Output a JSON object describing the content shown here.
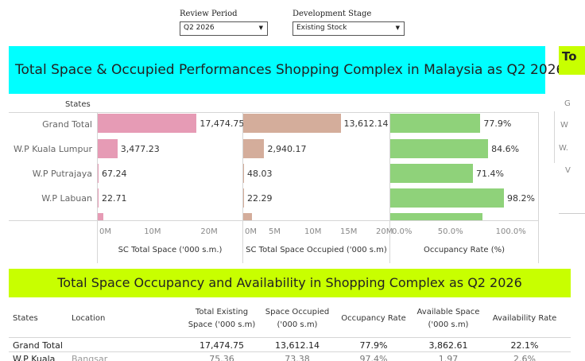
{
  "filters": {
    "review_period": {
      "label": "Review Period",
      "value": "Q2 2026"
    },
    "development_stage": {
      "label": "Development Stage",
      "value": "Existing Stock"
    }
  },
  "header": {
    "title": "Total Space & Occupied Performances Shopping Complex in Malaysia  as Q2 2026",
    "side_title": "To"
  },
  "side_panel": {
    "items": [
      "G",
      "W",
      "W.",
      "V"
    ]
  },
  "colors": {
    "cyan_band": "#00ffff",
    "lime_band": "#c8ff00",
    "pink_bar": "#e69bb5",
    "tan_bar": "#d4ad9b",
    "green_bar": "#8fd27a"
  },
  "chart_data": [
    {
      "type": "bar",
      "orientation": "horizontal",
      "categories": [
        "Grand Total",
        "W.P Kuala Lumpur",
        "W.P Putrajaya",
        "W.P Labuan",
        ""
      ],
      "values": [
        17474.75,
        3477.23,
        67.24,
        22.71,
        1000
      ],
      "labels": [
        "17,474.75",
        "3,477.23",
        "67.24",
        "22.71",
        ""
      ],
      "xlabel": "SC Total Space ('000 s.m.)",
      "ticks": [
        "0M",
        "10M",
        "20M"
      ],
      "xlim": [
        0,
        25000
      ],
      "color": "#e69bb5"
    },
    {
      "type": "bar",
      "orientation": "horizontal",
      "categories": [
        "Grand Total",
        "W.P Kuala Lumpur",
        "W.P Putrajaya",
        "W.P Labuan",
        ""
      ],
      "values": [
        13612.14,
        2940.17,
        48.03,
        22.29,
        1200
      ],
      "labels": [
        "13,612.14",
        "2,940.17",
        "48.03",
        "22.29",
        ""
      ],
      "xlabel": "SC Total Space Occupied ('000 s.m)",
      "ticks": [
        "0M",
        "5M",
        "10M",
        "15M",
        "20M"
      ],
      "xlim": [
        0,
        20000
      ],
      "color": "#d4ad9b"
    },
    {
      "type": "bar",
      "orientation": "horizontal",
      "categories": [
        "Grand Total",
        "W.P Kuala Lumpur",
        "W.P Putrajaya",
        "W.P Labuan",
        ""
      ],
      "values": [
        77.9,
        84.6,
        71.4,
        98.2,
        80.0
      ],
      "labels": [
        "77.9%",
        "84.6%",
        "71.4%",
        "98.2%",
        ""
      ],
      "xlabel": "Occupancy Rate (%)",
      "ticks": [
        "0.0%",
        "50.0%",
        "100.0%"
      ],
      "xlim": [
        0,
        125
      ],
      "color": "#8fd27a"
    }
  ],
  "charts": {
    "states_header": "States",
    "row_labels": [
      "Grand Total",
      "W.P Kuala Lumpur",
      "W.P Putrajaya",
      "W.P Labuan"
    ]
  },
  "lower": {
    "title": "Total Space Occupancy and Availability in Shopping Complex as Q2 2026",
    "headers": {
      "states": "States",
      "location": "Location",
      "total_existing_1": "Total Existing",
      "total_existing_2": "Space ('000 s.m)",
      "space_occupied_1": "Space Occupied",
      "space_occupied_2": "('000 s.m)",
      "occupancy_rate": "Occupancy Rate",
      "available_1": "Available Space",
      "available_2": "('000 s.m)",
      "availability_rate": "Availability Rate"
    },
    "rows": [
      {
        "state": "Grand Total",
        "location": "",
        "total": "17,474.75",
        "occupied": "13,612.14",
        "occ_rate": "77.9%",
        "available": "3,862.61",
        "avail_rate": "22.1%"
      },
      {
        "state": "W.P Kuala",
        "location": "Bangsar",
        "total": "75.36",
        "occupied": "73.38",
        "occ_rate": "97.4%",
        "available": "1.97",
        "avail_rate": "2.6%"
      }
    ]
  }
}
